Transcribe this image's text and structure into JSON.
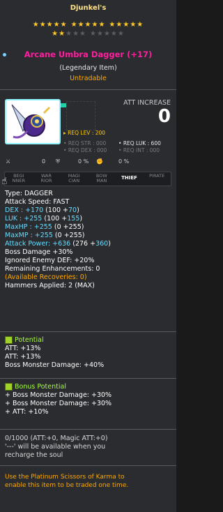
{
  "owner": "Djunkel's",
  "stars_row1": {
    "filled": 15,
    "total": 15
  },
  "stars_row2": {
    "filled": 2,
    "total": 10
  },
  "item_name": "Arcane Umbra Dagger (+17)",
  "grade": "(Legendary Item)",
  "trade_status": "Untradable",
  "att_increase_label": "ATT INCREASE",
  "att_increase_value": "0",
  "req_lev": "REQ LEV : 200",
  "req_str": "REQ STR : 000",
  "req_dex": "REQ DEX : 000",
  "req_luk": "REQ LUK : 600",
  "req_int": "REQ INT : 000",
  "mini_stats": [
    "0",
    "0 %",
    "0 %"
  ],
  "jobs": [
    {
      "top": "BEGI",
      "bot": "NNER",
      "selected": false
    },
    {
      "top": "WAR",
      "bot": "RIOR",
      "selected": false
    },
    {
      "top": "MAGI",
      "bot": "CIAN",
      "selected": false
    },
    {
      "top": "BOW",
      "bot": "MAN",
      "selected": false
    },
    {
      "top": "THIEF",
      "bot": "",
      "selected": true
    },
    {
      "top": "PIRATE",
      "bot": "",
      "selected": false
    }
  ],
  "stats": {
    "type": "Type:  DAGGER",
    "speed": "Attack Speed:  FAST",
    "dex": "DEX : +170",
    "dex_b": " (100 +",
    "dex_c": "70",
    "luk": "LUK : +255",
    "luk_b": " (100 +",
    "luk_c": "155",
    "hp": "MaxHP : +255",
    "hp_b": " (0 +255)",
    "mp": "MaxMP : +255",
    "mp_b": " (0 +255)",
    "atk": "Attack Power: +636",
    "atk_b": " (276 +",
    "atk_c": "360",
    "boss": "Boss Damage +30%",
    "ied": "Ignored Enemy DEF: +20%",
    "enh": "Remaining Enhancements: 0",
    "recov": "(Available Recoveries: 0)",
    "hammer": "Hammers Applied: 2 (MAX)"
  },
  "potential": {
    "title": "Potential",
    "lines": [
      "ATT: +13%",
      "ATT: +13%",
      "Boss Monster Damage: +40%"
    ]
  },
  "bonus": {
    "title": "Bonus Potential",
    "lines": [
      "+ Boss Monster Damage: +30%",
      "+ Boss Monster Damage: +30%",
      "+ ATT: +10%"
    ]
  },
  "soul": {
    "line1": "0/1000 (ATT:+0, Magic ATT:+0)",
    "line2": "'---' will be available when you",
    "line3": "recharge the soul"
  },
  "karma": {
    "line1": "Use the Platinum Scissors of Karma  to",
    "line2": "enable this item to be traded one time."
  }
}
